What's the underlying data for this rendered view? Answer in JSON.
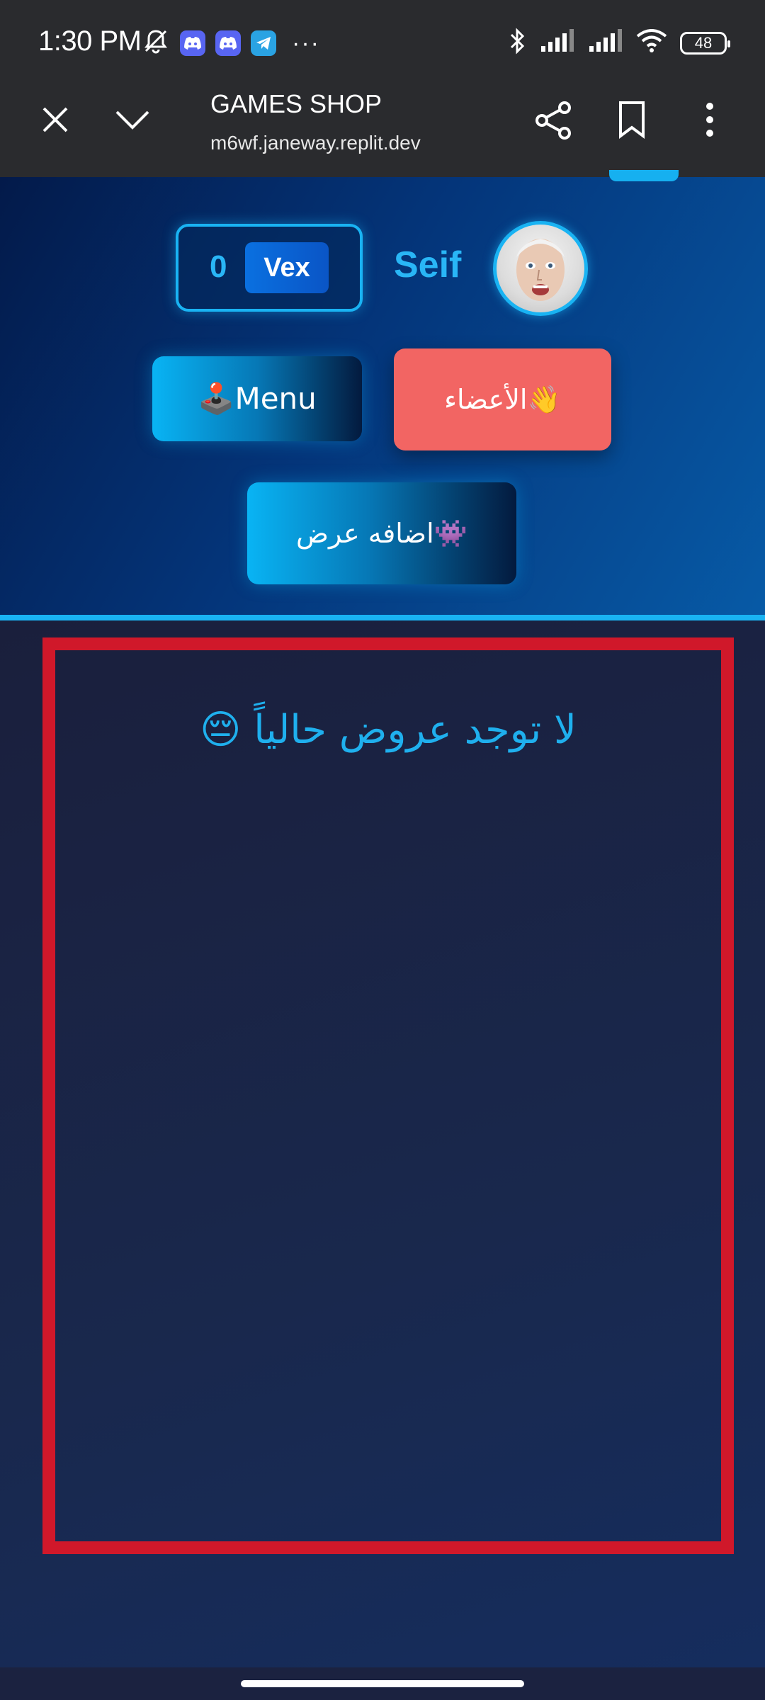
{
  "status_bar": {
    "time": "1:30 PM",
    "icons": [
      "mute-icon",
      "discord-icon",
      "discord-icon",
      "telegram-icon",
      "more-dots-icon",
      "bluetooth-icon",
      "signal-icon",
      "signal-icon",
      "wifi-icon",
      "battery-icon"
    ],
    "more": "···",
    "battery": "48"
  },
  "browser": {
    "title": "GAMES SHOP",
    "url": "m6wf.janeway.replit.dev"
  },
  "header": {
    "balance_value": "0",
    "currency": "Vex",
    "username": "Seif",
    "menu_button": "🕹️Menu",
    "members_button": "الأعضاء👋",
    "add_offer_button": "اضافه عرض👾"
  },
  "offers": {
    "empty_message": "لا توجد عروض حالياً 😔"
  },
  "colors": {
    "accent": "#19b3f3",
    "members_button": "#f26563",
    "panel_border": "#d0182a",
    "background": "#1b2240"
  }
}
